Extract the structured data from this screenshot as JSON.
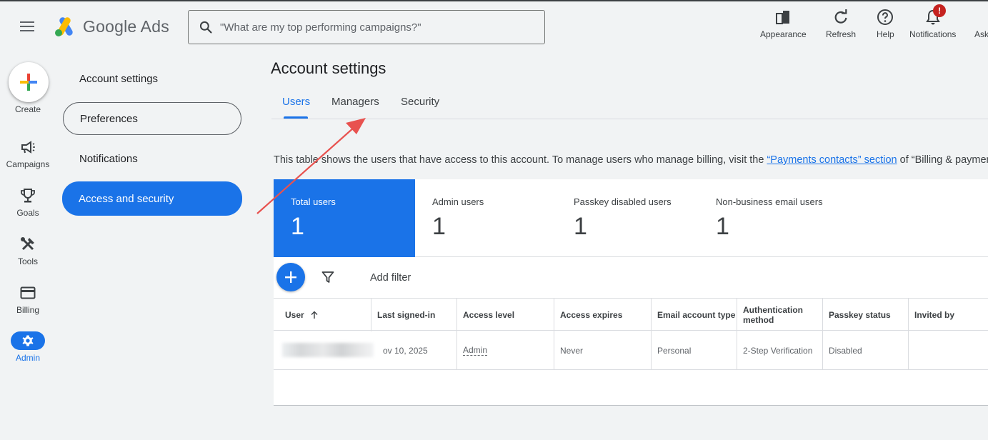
{
  "app": {
    "logo_text": "Google Ads",
    "search_placeholder": "\"What are my top performing campaigns?\""
  },
  "header": {
    "appearance": "Appearance",
    "refresh": "Refresh",
    "help": "Help",
    "notifications": "Notifications",
    "notification_badge": "!",
    "ask": "Ask"
  },
  "rail": {
    "create": "Create",
    "campaigns": "Campaigns",
    "goals": "Goals",
    "tools": "Tools",
    "billing": "Billing",
    "admin": "Admin"
  },
  "subnav": {
    "account_settings": "Account settings",
    "preferences": "Preferences",
    "notifications": "Notifications",
    "access_security": "Access and security"
  },
  "main": {
    "title": "Account settings",
    "tabs": [
      "Users",
      "Managers",
      "Security"
    ],
    "description_prefix": "This table shows the users that have access to this account. To manage users who manage billing, visit the ",
    "description_link": "“Payments contacts” section",
    "description_suffix": " of “Billing & paymen"
  },
  "stats": [
    {
      "label": "Total users",
      "value": "1"
    },
    {
      "label": "Admin users",
      "value": "1"
    },
    {
      "label": "Passkey disabled users",
      "value": "1"
    },
    {
      "label": "Non-business email users",
      "value": "1"
    }
  ],
  "toolbar": {
    "add_filter": "Add filter"
  },
  "table": {
    "columns": [
      "User",
      "Last signed-in",
      "Access level",
      "Access expires",
      "Email account type",
      "Authentication method",
      "Passkey status",
      "Invited by"
    ],
    "rows": [
      {
        "last_signed_in": "ov 10, 2025",
        "access_level": "Admin",
        "access_expires": "Never",
        "email_account_type": "Personal",
        "authentication_method": "2-Step Verification",
        "passkey_status": "Disabled",
        "invited_by": ""
      }
    ]
  },
  "colors": {
    "accent": "#1a73e8",
    "annotation_arrow": "#e8524f",
    "badge": "#c5221f"
  }
}
